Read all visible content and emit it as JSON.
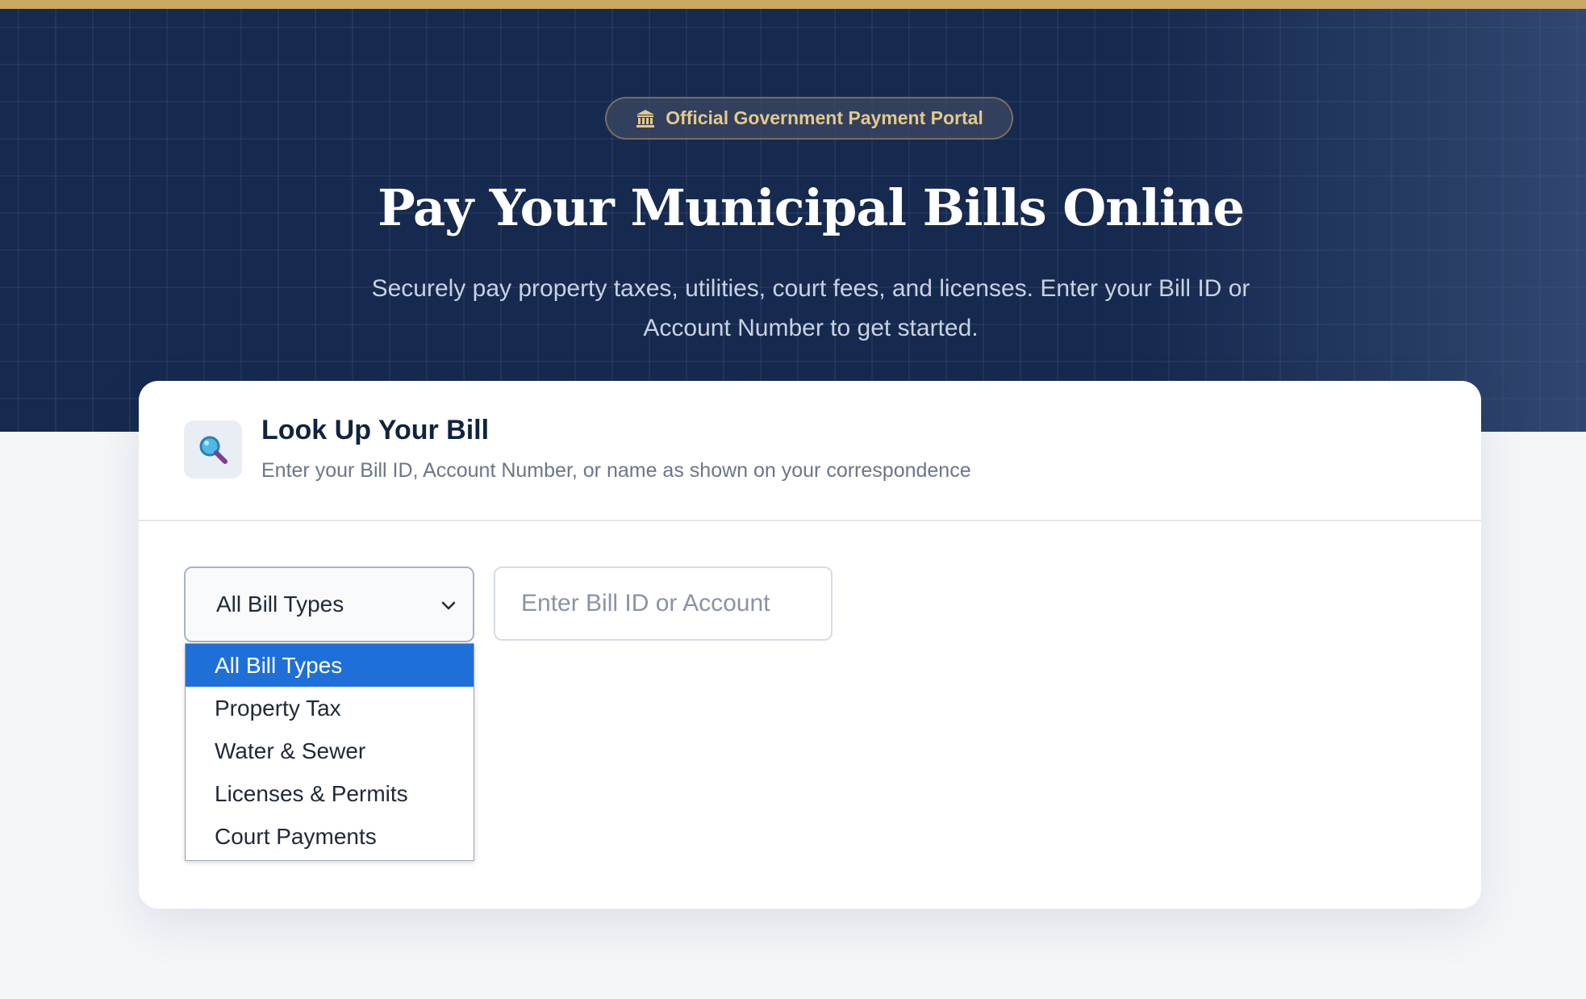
{
  "hero": {
    "badge": {
      "icon": "government-building-icon",
      "label": "Official Government Payment Portal"
    },
    "title": "Pay Your Municipal Bills Online",
    "subtitle": "Securely pay property taxes, utilities, court fees, and licenses. Enter your Bill ID or Account Number to get started."
  },
  "lookup": {
    "icon": "magnifying-glass-icon",
    "title": "Look Up Your Bill",
    "description": "Enter your Bill ID, Account Number, or name as shown on your correspondence",
    "bill_type": {
      "selected": "All Bill Types",
      "options": [
        {
          "label": "All Bill Types",
          "selected": true
        },
        {
          "label": "Property Tax",
          "selected": false
        },
        {
          "label": "Water & Sewer",
          "selected": false
        },
        {
          "label": "Licenses & Permits",
          "selected": false
        },
        {
          "label": "Court Payments",
          "selected": false
        }
      ]
    },
    "search": {
      "value": "",
      "placeholder": "Enter Bill ID or Account"
    }
  },
  "colors": {
    "hero_bg": "#16294f",
    "accent_gold": "#c9a961",
    "selected_option": "#1f6fd9",
    "page_bg": "#f4f6f9"
  }
}
